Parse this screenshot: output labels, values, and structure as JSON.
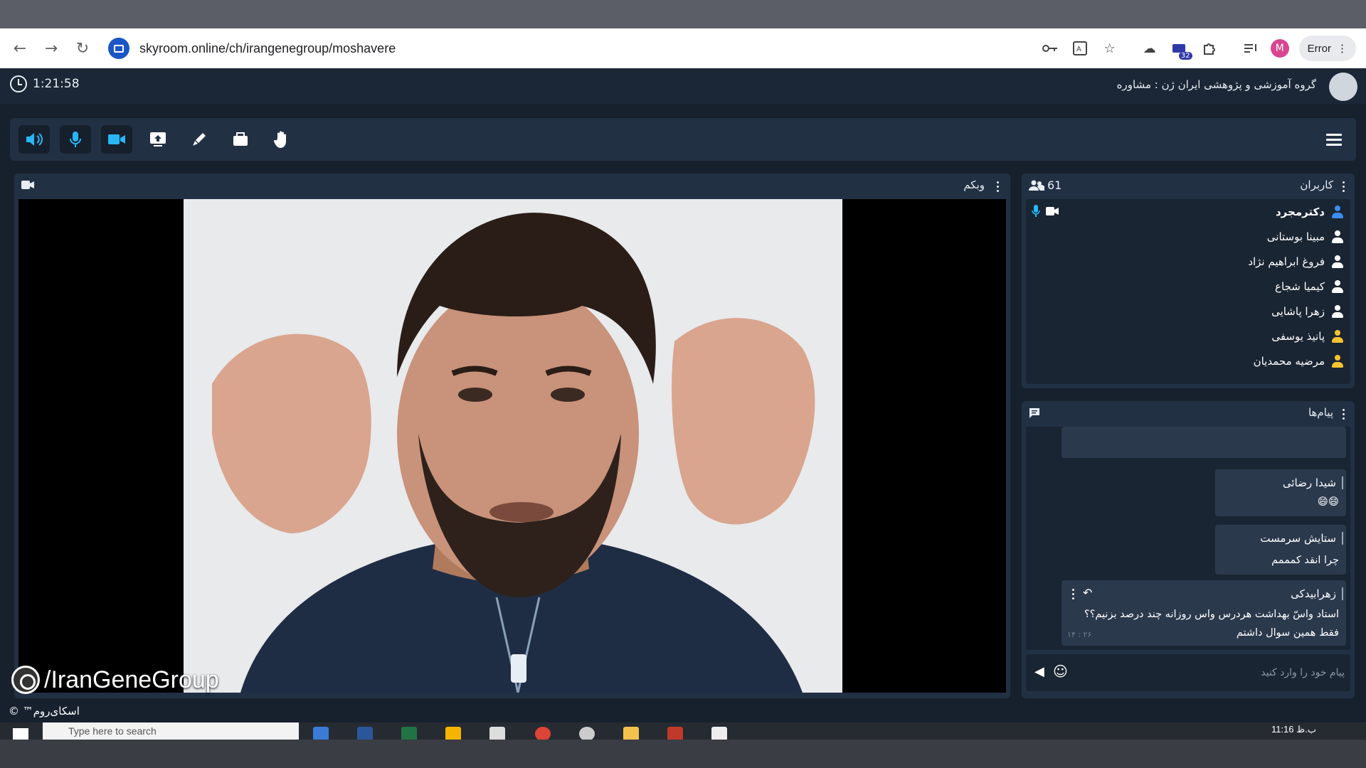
{
  "browser": {
    "url": "skyroom.online/ch/irangenegroup/moshavere",
    "profile_initial": "M",
    "extension_badge": "32",
    "error_label": "Error"
  },
  "header": {
    "timer": "1:21:58",
    "room_title": "گروه آموزشی و پژوهشی ایران ژن : مشاوره"
  },
  "toolbar": {
    "tools": [
      "speaker-icon",
      "microphone-icon",
      "camera-icon",
      "screen-share-icon",
      "whiteboard-pen-icon",
      "file-folder-icon",
      "raise-hand-icon"
    ],
    "accent": "#29b6f6"
  },
  "webcam": {
    "title": "وبکم"
  },
  "users": {
    "title": "کاربران",
    "count": "61",
    "list": [
      {
        "name": "دکترمجرد",
        "color": "#3b8ef0"
      },
      {
        "name": "مبینا بوستانی",
        "color": "#ffffff"
      },
      {
        "name": "فروغ ابراهیم نژاد",
        "color": "#ffffff"
      },
      {
        "name": "کیمیا شجاع",
        "color": "#ffffff"
      },
      {
        "name": "زهرا پاشایی",
        "color": "#ffffff"
      },
      {
        "name": "پانیذ یوسفی",
        "color": "#f4c430"
      },
      {
        "name": "مرضیه محمدیان",
        "color": "#f4c430"
      }
    ]
  },
  "messages": {
    "title": "پیام‌ها",
    "items": [
      {
        "name": "شیدا رضائی",
        "text": "😄😄"
      },
      {
        "name": "ستایش سرمست",
        "text": "چرا انقد کمممم"
      },
      {
        "name": "زهرابیدکی",
        "line1": "استاد واسّ بهداشت هردرس واس روزانه چند درصد بزنیم؟؟",
        "line2": "فقط همین سوال داشتم",
        "time": "۲۶ : ۱۴"
      }
    ],
    "input_placeholder": "پیام خود را وارد کنید"
  },
  "overlay": {
    "watermark": "/IranGeneGroup",
    "brand": "اسکای‌روم™ ©"
  },
  "taskbar": {
    "search_placeholder": "Type here to search",
    "time": "11:16 ب.ظ"
  }
}
